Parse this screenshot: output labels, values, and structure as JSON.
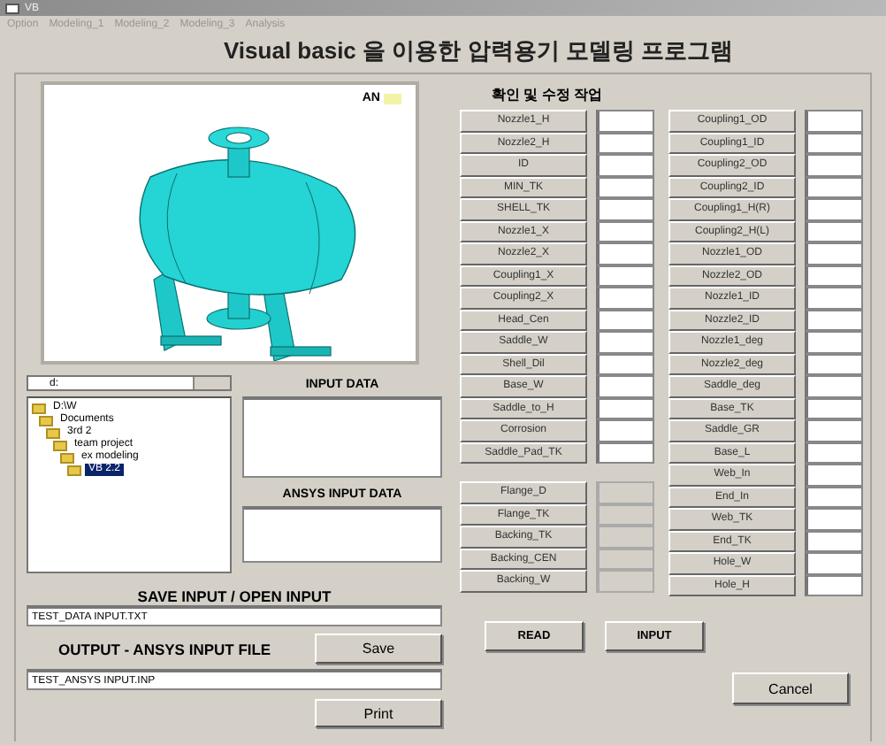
{
  "window": {
    "title": "VB"
  },
  "menu": [
    "Option",
    "Modeling_1",
    "Modeling_2",
    "Modeling_3",
    "Analysis"
  ],
  "heading": "Visual basic 을 이용한 압력용기 모델링 프로그램",
  "viewer": {
    "logo": "AN"
  },
  "drive": "d:",
  "tree": [
    {
      "label": "D:\\W",
      "selected": false,
      "children": [
        {
          "label": "Documents",
          "selected": false,
          "children": [
            {
              "label": "3rd 2",
              "selected": false,
              "children": [
                {
                  "label": "team project",
                  "selected": false,
                  "children": [
                    {
                      "label": "ex modeling",
                      "selected": false,
                      "children": [
                        {
                          "label": "VB 2.2",
                          "selected": true
                        }
                      ]
                    }
                  ]
                }
              ]
            }
          ]
        }
      ]
    }
  ],
  "input_data": {
    "title": "INPUT DATA"
  },
  "ansys_input_data": {
    "title": "ANSYS INPUT DATA"
  },
  "save_open": {
    "title": "SAVE INPUT / OPEN INPUT",
    "value": "TEST_DATA INPUT.TXT"
  },
  "output": {
    "title": "OUTPUT - ANSYS INPUT FILE",
    "value": "TEST_ANSYS INPUT.INP"
  },
  "buttons": {
    "save": "Save",
    "print": "Print",
    "read": "READ",
    "input": "INPUT",
    "cancel": "Cancel"
  },
  "section_title": "확인 및 수정 작업",
  "left_params": [
    {
      "label": "Nozzle1_H",
      "disabled": false
    },
    {
      "label": "Nozzle2_H",
      "disabled": false
    },
    {
      "label": "ID",
      "disabled": false
    },
    {
      "label": "MIN_TK",
      "disabled": false
    },
    {
      "label": "SHELL_TK",
      "disabled": false
    },
    {
      "label": "Nozzle1_X",
      "disabled": false
    },
    {
      "label": "Nozzle2_X",
      "disabled": false
    },
    {
      "label": "Coupling1_X",
      "disabled": false
    },
    {
      "label": "Coupling2_X",
      "disabled": false
    },
    {
      "label": "Head_Cen",
      "disabled": false
    },
    {
      "label": "Saddle_W",
      "disabled": false
    },
    {
      "label": "Shell_Dil",
      "disabled": false
    },
    {
      "label": "Base_W",
      "disabled": false
    },
    {
      "label": "Saddle_to_H",
      "disabled": false
    },
    {
      "label": "Corrosion",
      "disabled": false
    },
    {
      "label": "Saddle_Pad_TK",
      "disabled": false
    }
  ],
  "flange_params": [
    {
      "label": "Flange_D",
      "disabled": true
    },
    {
      "label": "Flange_TK",
      "disabled": true
    },
    {
      "label": "Backing_TK",
      "disabled": true
    },
    {
      "label": "Backing_CEN",
      "disabled": true
    },
    {
      "label": "Backing_W",
      "disabled": true
    }
  ],
  "right_params": [
    {
      "label": "Coupling1_OD",
      "disabled": false
    },
    {
      "label": "Coupling1_ID",
      "disabled": false
    },
    {
      "label": "Coupling2_OD",
      "disabled": false
    },
    {
      "label": "Coupling2_ID",
      "disabled": false
    },
    {
      "label": "Coupling1_H(R)",
      "disabled": false
    },
    {
      "label": "Coupling2_H(L)",
      "disabled": false
    },
    {
      "label": "Nozzle1_OD",
      "disabled": false
    },
    {
      "label": "Nozzle2_OD",
      "disabled": false
    },
    {
      "label": "Nozzle1_ID",
      "disabled": false
    },
    {
      "label": "Nozzle2_ID",
      "disabled": false
    },
    {
      "label": "Nozzle1_deg",
      "disabled": false
    },
    {
      "label": "Nozzle2_deg",
      "disabled": false
    },
    {
      "label": "Saddle_deg",
      "disabled": false
    },
    {
      "label": "Base_TK",
      "disabled": false
    },
    {
      "label": "Saddle_GR",
      "disabled": false
    },
    {
      "label": "Base_L",
      "disabled": false
    },
    {
      "label": "Web_In",
      "disabled": false
    },
    {
      "label": "End_In",
      "disabled": false
    },
    {
      "label": "Web_TK",
      "disabled": false
    },
    {
      "label": "End_TK",
      "disabled": false
    },
    {
      "label": "Hole_W",
      "disabled": false
    },
    {
      "label": "Hole_H",
      "disabled": false
    }
  ]
}
